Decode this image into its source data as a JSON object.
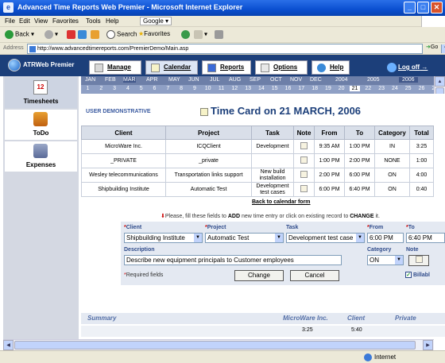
{
  "window": {
    "title": "Advanced Time Reports Web Premier - Microsoft Internet Explorer"
  },
  "menubar": {
    "items": [
      "File",
      "Edit",
      "View",
      "Favorites",
      "Tools",
      "Help"
    ],
    "google": "Google"
  },
  "toolbar": {
    "back": "Back",
    "search": "Search",
    "favorites": "Favorites"
  },
  "address": {
    "label": "Address",
    "url": "http://www.advancedtimereports.com/PremierDemo/Main.asp",
    "go": "Go"
  },
  "app": {
    "logo": "ATRWeb Premier",
    "tabs": [
      "Manage",
      "Calendar",
      "Reports",
      "Options",
      "Help"
    ],
    "logoff": "Log off"
  },
  "sidebar": {
    "items": [
      "Timesheets",
      "ToDo",
      "Expenses"
    ],
    "calendar_day": "12"
  },
  "calendar": {
    "months": [
      "JAN",
      "FEB",
      "MAR",
      "APR",
      "MAY",
      "JUN",
      "JUL",
      "AUG",
      "SEP",
      "OCT",
      "NOV",
      "DEC"
    ],
    "years": [
      "2004",
      "2005",
      "2006"
    ],
    "days": [
      "1",
      "2",
      "3",
      "4",
      "5",
      "6",
      "7",
      "8",
      "9",
      "10",
      "11",
      "12",
      "13",
      "14",
      "15",
      "16",
      "17",
      "18",
      "19",
      "20",
      "21",
      "22",
      "23",
      "24",
      "25",
      "26",
      "27"
    ],
    "selected_day": "21"
  },
  "main": {
    "user": "USER DEMONSTRATIVE",
    "title": "Time Card on 21 MARCH, 2006",
    "columns": [
      "Client",
      "Project",
      "Task",
      "Note",
      "From",
      "To",
      "Category",
      "Total"
    ],
    "rows": [
      {
        "client": "MicroWare Inc.",
        "project": "ICQClient",
        "task": "Development",
        "from": "9:35 AM",
        "to": "1:00 PM",
        "category": "IN",
        "total": "3:25"
      },
      {
        "client": "_PRIVATE",
        "project": "_private",
        "task": "",
        "from": "1:00 PM",
        "to": "2:00 PM",
        "category": "NONE",
        "total": "1:00"
      },
      {
        "client": "Wesley telecommunications",
        "project": "Transportation links support",
        "task": "New build installation",
        "from": "2:00 PM",
        "to": "6:00 PM",
        "category": "ON",
        "total": "4:00"
      },
      {
        "client": "Shipbuilding Institute",
        "project": "Automatic Test",
        "task": "Development test cases",
        "from": "6:00 PM",
        "to": "6:40 PM",
        "category": "ON",
        "total": "0:40"
      }
    ],
    "back_link": "Back to calendar form",
    "hint_pre": "Please, fill these fields to",
    "hint_add": "ADD",
    "hint_mid": "new time entry or click on existing record to",
    "hint_change": "CHANGE",
    "hint_end": "it."
  },
  "form": {
    "client_label": "Client",
    "project_label": "Project",
    "task_label": "Task",
    "from_label": "From",
    "to_label": "To",
    "description_label": "Description",
    "category_label": "Category",
    "note_label": "Note",
    "client_value": "Shipbuilding Institute",
    "project_value": "Automatic Test",
    "task_value": "Development test case",
    "from_value": "6:00 PM",
    "to_value": "6:40 PM",
    "description_value": "Describe new equipment principals to Customer employees",
    "category_value": "ON",
    "required_note": "Required fields",
    "change_button": "Change",
    "cancel_button": "Cancel",
    "billable_label": "Billabl"
  },
  "summary": {
    "label": "Summary",
    "columns": [
      "MicroWare Inc.",
      "Client",
      "Private"
    ],
    "values": [
      "3:25",
      "5:40"
    ]
  },
  "status": {
    "zone": "Internet"
  }
}
